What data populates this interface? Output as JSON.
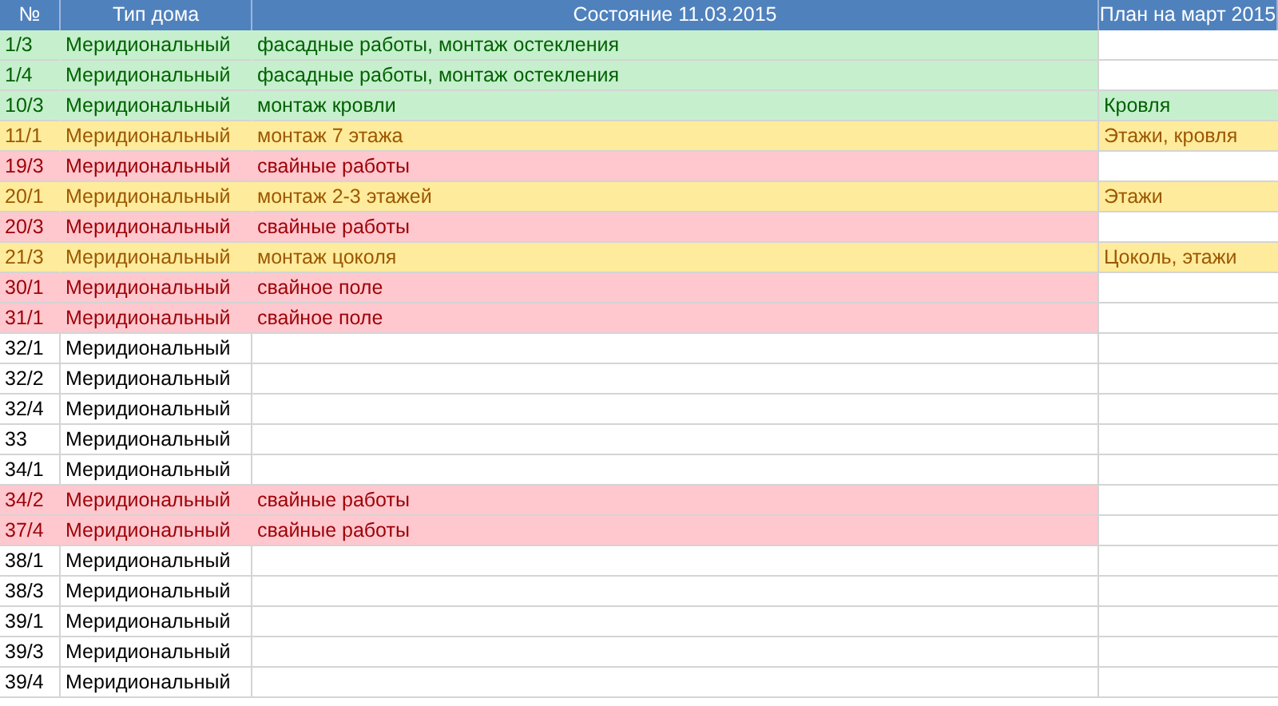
{
  "columns": [
    "№",
    "Тип дома",
    "Состояние 11.03.2015",
    "План на март 2015"
  ],
  "rows": [
    {
      "number": "1/3",
      "type": "Меридиональный",
      "state": "фасадные работы, монтаж остекления",
      "color": "#c6efce"
    },
    {
      "number": "1/4",
      "type": "Меридиональный",
      "state": "фасадные работы, монтаж остекления",
      "color": "#c6efce"
    },
    {
      "number": "10/3",
      "type": "Меридиональный",
      "state": "монтаж кровли",
      "plan": "Кровля",
      "color": "#c6efce"
    },
    {
      "number": "11/1",
      "type": "Меридиональный",
      "state": "монтаж 7 этажа",
      "plan": "Этажи, кровля",
      "color": "#ffeb9c"
    },
    {
      "number": "19/3",
      "type": "Меридиональный",
      "state": "свайные работы",
      "color": "#ffc7ce"
    },
    {
      "number": "20/1",
      "type": "Меридиональный",
      "state": "монтаж 2-3 этажей",
      "plan": "Этажи",
      "color": "#ffeb9c"
    },
    {
      "number": "20/3",
      "type": "Меридиональный",
      "state": "свайные работы",
      "color": "#ffc7ce"
    },
    {
      "number": "21/3",
      "type": "Меридиональный",
      "state": "монтаж цоколя",
      "plan": "Цоколь, этажи",
      "color": "#ffeb9c"
    },
    {
      "number": "30/1",
      "type": "Меридиональный",
      "state": "свайное поле",
      "color": "#ffc7ce"
    },
    {
      "number": "31/1",
      "type": "Меридиональный",
      "state": "свайное поле",
      "color": "#ffc7ce"
    },
    {
      "number": "32/1",
      "type": "Меридиональный"
    },
    {
      "number": "32/2",
      "type": "Меридиональный"
    },
    {
      "number": "32/4",
      "type": "Меридиональный"
    },
    {
      "number": "33",
      "type": "Меридиональный"
    },
    {
      "number": "34/1",
      "type": "Меридиональный"
    },
    {
      "number": "34/2",
      "type": "Меридиональный",
      "state": "свайные работы",
      "color": "#ffc7ce"
    },
    {
      "number": "37/4",
      "type": "Меридиональный",
      "state": "свайные работы",
      "color": "#ffc7ce"
    },
    {
      "number": "38/1",
      "type": "Меридиональный"
    },
    {
      "number": "38/3",
      "type": "Меридиональный"
    },
    {
      "number": "39/1",
      "type": "Меридиональный"
    },
    {
      "number": "39/3",
      "type": "Меридиональный"
    },
    {
      "number": "39/4",
      "type": "Меридиональный"
    }
  ]
}
